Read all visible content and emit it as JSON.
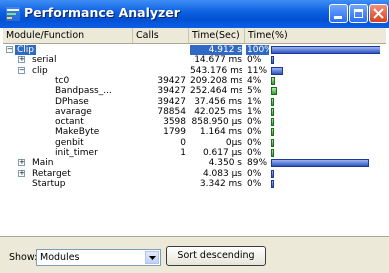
{
  "window": {
    "title": "Performance Analyzer",
    "accent": "#0a5fe0",
    "icons": [
      "app-icon",
      "minimize-icon",
      "maximize-icon",
      "close-icon"
    ]
  },
  "columns": {
    "name": "Module/Function",
    "calls": "Calls",
    "time": "Time(Sec)",
    "pct": "Time(%)"
  },
  "rows": [
    {
      "name": "Clip",
      "calls": "",
      "time": "4.912 s",
      "pct": "100%",
      "bar_fraction": 1.0,
      "bar_color": "blue",
      "expander": "−",
      "level": 0,
      "selected": true
    },
    {
      "name": "serial",
      "calls": "",
      "time": "14.677 ms",
      "pct": "0%",
      "bar_fraction": 0.0,
      "bar_color": "blue",
      "expander": "+",
      "level": 1
    },
    {
      "name": "clip",
      "calls": "",
      "time": "543.176 ms",
      "pct": "11%",
      "bar_fraction": 0.11,
      "bar_color": "blue",
      "expander": "−",
      "level": 1
    },
    {
      "name": "tc0",
      "calls": "39427",
      "time": "209.208 ms",
      "pct": "4%",
      "bar_fraction": 0.04,
      "bar_color": "green",
      "level": 2
    },
    {
      "name": "Bandpass_...",
      "calls": "39427",
      "time": "252.464 ms",
      "pct": "5%",
      "bar_fraction": 0.05,
      "bar_color": "green",
      "level": 2
    },
    {
      "name": "DPhase",
      "calls": "39427",
      "time": "37.456 ms",
      "pct": "1%",
      "bar_fraction": 0.01,
      "bar_color": "green",
      "level": 2
    },
    {
      "name": "avarage",
      "calls": "78854",
      "time": "42.025 ms",
      "pct": "1%",
      "bar_fraction": 0.01,
      "bar_color": "green",
      "level": 2
    },
    {
      "name": "octant",
      "calls": "3598",
      "time": "858.950 µs",
      "pct": "0%",
      "bar_fraction": 0.0,
      "bar_color": "green",
      "level": 2
    },
    {
      "name": "MakeByte",
      "calls": "1799",
      "time": "1.164 ms",
      "pct": "0%",
      "bar_fraction": 0.0,
      "bar_color": "green",
      "level": 2
    },
    {
      "name": "genbit",
      "calls": "0",
      "time": "0µs",
      "pct": "0%",
      "bar_fraction": 0.0,
      "bar_color": "green",
      "level": 2
    },
    {
      "name": "init_timer",
      "calls": "1",
      "time": "0.617 µs",
      "pct": "0%",
      "bar_fraction": 0.0,
      "bar_color": "green",
      "level": 2
    },
    {
      "name": "Main",
      "calls": "",
      "time": "4.350 s",
      "pct": "89%",
      "bar_fraction": 0.89,
      "bar_color": "blue",
      "expander": "+",
      "level": 1
    },
    {
      "name": "Retarget",
      "calls": "",
      "time": "4.083 µs",
      "pct": "0%",
      "bar_fraction": 0.0,
      "bar_color": "blue",
      "expander": "+",
      "level": 1
    },
    {
      "name": "Startup",
      "calls": "",
      "time": "3.342 ms",
      "pct": "0%",
      "bar_fraction": 0.0,
      "bar_color": "blue",
      "level": 1
    }
  ],
  "bottom": {
    "show_label": "Show:",
    "show_value": "Modules",
    "sort_button": "Sort descending"
  }
}
